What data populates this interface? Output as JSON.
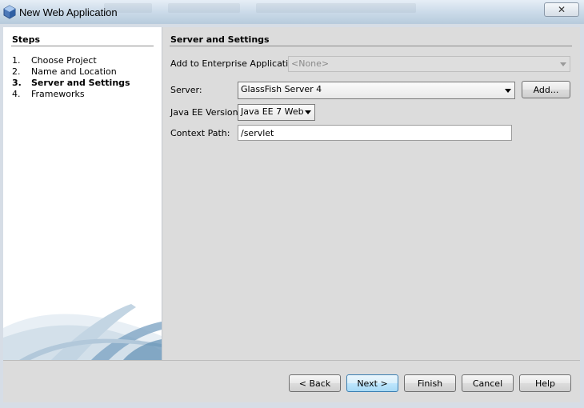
{
  "window": {
    "title": "New Web Application",
    "close_symbol": "✕"
  },
  "steps": {
    "heading": "Steps",
    "items": [
      {
        "num": "1.",
        "label": "Choose Project"
      },
      {
        "num": "2.",
        "label": "Name and Location"
      },
      {
        "num": "3.",
        "label": "Server and Settings"
      },
      {
        "num": "4.",
        "label": "Frameworks"
      }
    ],
    "current_index": 2
  },
  "content": {
    "heading": "Server and Settings",
    "enterprise": {
      "label": "Add to Enterprise Application:",
      "value": "<None>"
    },
    "server": {
      "label": "Server:",
      "value": "GlassFish Server 4",
      "add_label": "Add..."
    },
    "java_ee": {
      "label": "Java EE Version:",
      "value": "Java EE 7 Web"
    },
    "context_path": {
      "label": "Context Path:",
      "value": "/servlet"
    }
  },
  "buttons": {
    "back": "< Back",
    "next": "Next >",
    "finish": "Finish",
    "cancel": "Cancel",
    "help": "Help"
  },
  "colors": {
    "steps_background": "#ffffff",
    "content_background": "#dcdcdc",
    "default_button": "#bee6fd",
    "swoosh": "#5f8fb3"
  }
}
